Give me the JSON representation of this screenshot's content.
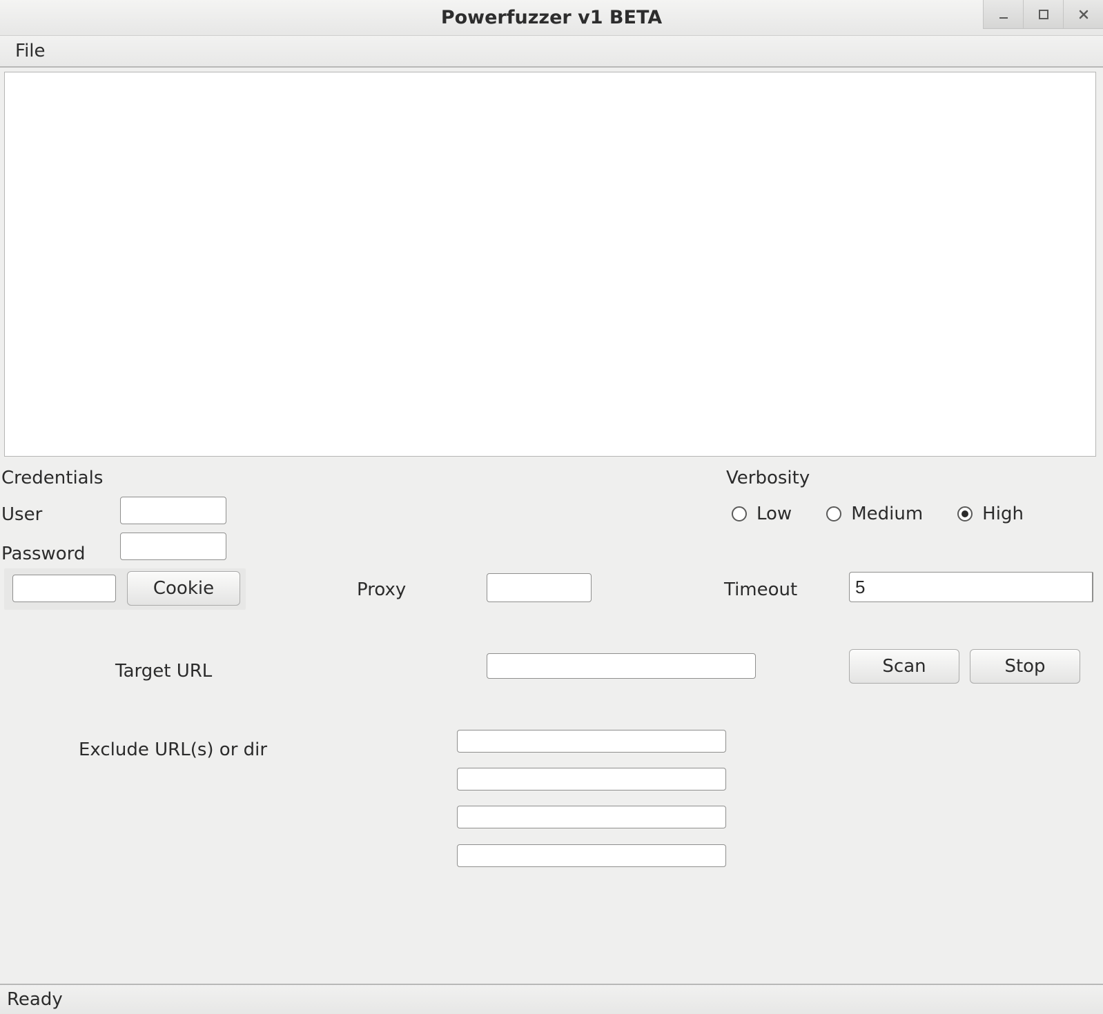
{
  "window": {
    "title": "Powerfuzzer v1 BETA"
  },
  "menu": {
    "file": "File"
  },
  "labels": {
    "credentials": "Credentials",
    "user": "User",
    "password": "Password",
    "verbosity": "Verbosity",
    "proxy": "Proxy",
    "timeout": "Timeout",
    "target_url": "Target URL",
    "exclude": "Exclude URL(s) or dir"
  },
  "verbosity": {
    "options": {
      "low": "Low",
      "medium": "Medium",
      "high": "High"
    },
    "selected": "high"
  },
  "credentials": {
    "user": "",
    "password": "",
    "cookie_value": "",
    "cookie_button": "Cookie"
  },
  "proxy": {
    "value": ""
  },
  "timeout": {
    "value": "5"
  },
  "target_url": {
    "value": ""
  },
  "exclude": {
    "v1": "",
    "v2": "",
    "v3": "",
    "v4": ""
  },
  "buttons": {
    "scan": "Scan",
    "stop": "Stop"
  },
  "status": {
    "text": "Ready"
  }
}
